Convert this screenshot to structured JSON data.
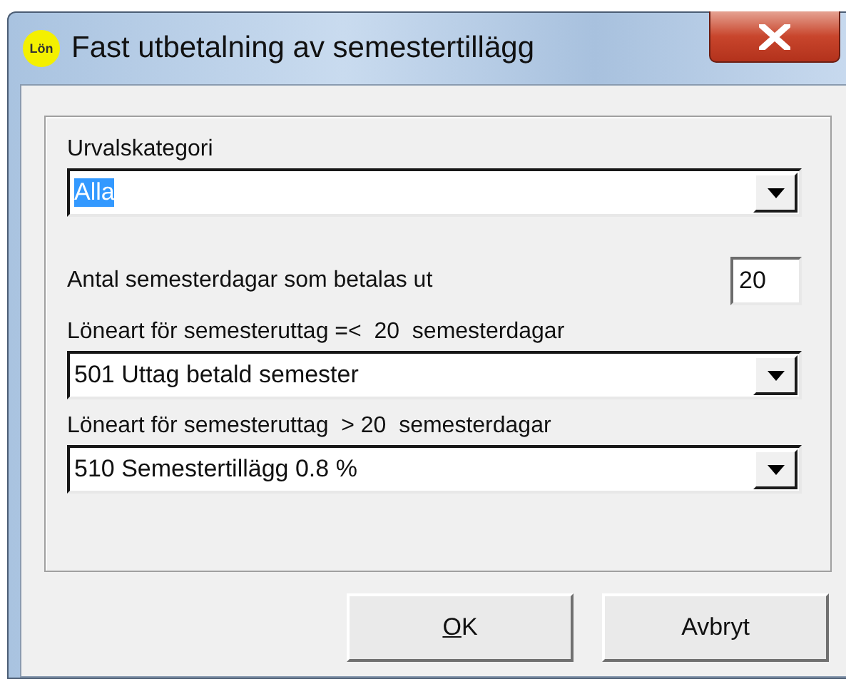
{
  "window": {
    "title": "Fast utbetalning av semestertillägg",
    "app_badge": "Lön"
  },
  "fields": [
    {
      "kind": "combo",
      "label": "Urvalskategori",
      "value": "Alla",
      "highlighted": true
    },
    {
      "kind": "number",
      "label": "Antal semesterdagar som betalas ut",
      "value": "20"
    },
    {
      "kind": "combo",
      "label": "Löneart för semesteruttag =<  20  semesterdagar",
      "value": "501 Uttag betald semester",
      "highlighted": false
    },
    {
      "kind": "combo",
      "label": "Löneart för semesteruttag  > 20  semesterdagar",
      "value": "510 Semestertillägg 0.8 %",
      "highlighted": false
    }
  ],
  "buttons": [
    {
      "label": "OK",
      "mnemonic_underlined": true
    },
    {
      "label": "Avbryt"
    }
  ]
}
